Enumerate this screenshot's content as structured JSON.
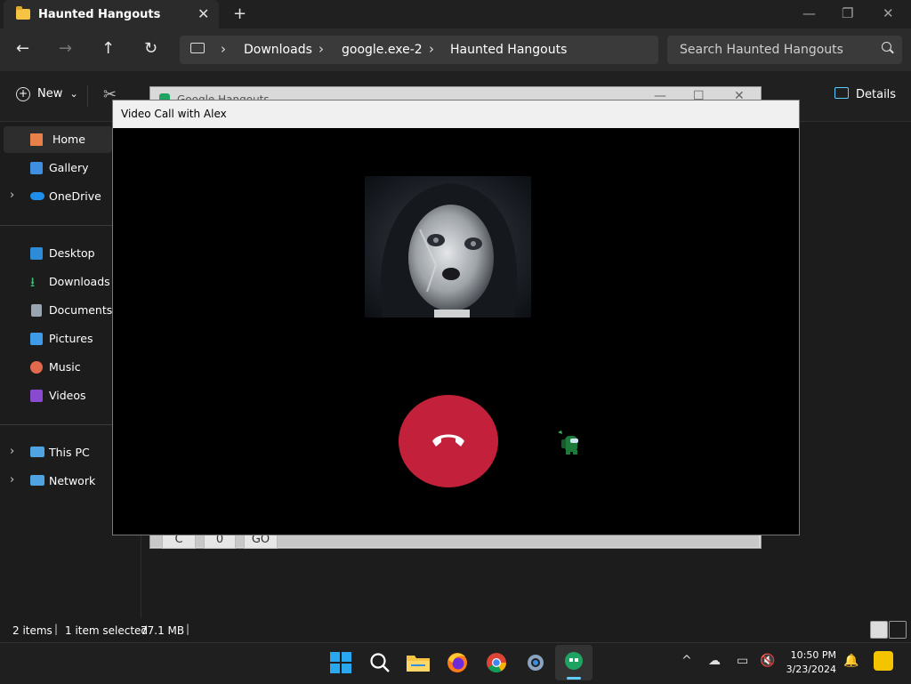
{
  "explorer": {
    "tab_title": "Haunted Hangouts",
    "new_tab": "+",
    "tab_close": "✕",
    "window_controls": {
      "minimize": "—",
      "maximize": "❐",
      "close": "✕"
    },
    "nav": {
      "back": "←",
      "forward": "→",
      "up": "↑",
      "refresh": "↻"
    },
    "breadcrumb": [
      "Downloads",
      "google.exe-2",
      "Haunted Hangouts"
    ],
    "breadcrumb_separator": "›",
    "search_placeholder": "Search Haunted Hangouts",
    "toolbar": {
      "new_label": "New",
      "new_chevron": "⌄",
      "details_label": "Details"
    },
    "sidebar": {
      "items": [
        {
          "label": "Home",
          "icon": "home-icon"
        },
        {
          "label": "Gallery",
          "icon": "gallery-icon"
        },
        {
          "label": "OneDrive",
          "icon": "cloud-icon"
        },
        {
          "label": "Desktop",
          "icon": "desktop-icon"
        },
        {
          "label": "Downloads",
          "icon": "download-icon"
        },
        {
          "label": "Documents",
          "icon": "document-icon"
        },
        {
          "label": "Pictures",
          "icon": "pictures-icon"
        },
        {
          "label": "Music",
          "icon": "music-icon"
        },
        {
          "label": "Videos",
          "icon": "videos-icon"
        },
        {
          "label": "This PC",
          "icon": "computer-icon"
        },
        {
          "label": "Network",
          "icon": "network-icon"
        }
      ],
      "expand_glyph": "›"
    },
    "status": {
      "items": "2 items",
      "selected": "1 item selected",
      "size": "77.1 MB",
      "separator": "|"
    }
  },
  "bg_window": {
    "title": "Google Hangouts",
    "keys": [
      "C",
      "0",
      "GO"
    ]
  },
  "video_call": {
    "title": "Video Call with Alex"
  },
  "taskbar": {
    "time": "10:50 PM",
    "date": "3/23/2024",
    "tray_chevron": "^",
    "notification_icon": "bell-icon"
  }
}
